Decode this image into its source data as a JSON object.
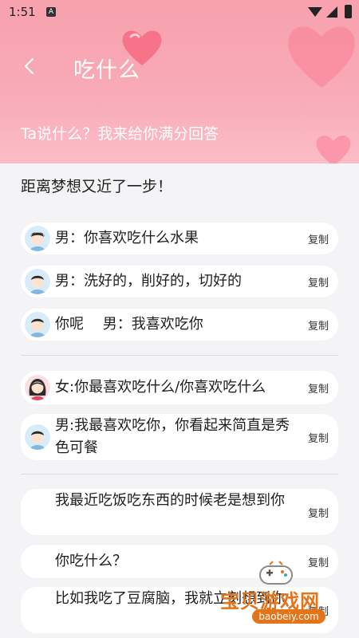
{
  "status_bar": {
    "time": "1:51",
    "notif_letter": "A"
  },
  "header": {
    "title": "吃什么",
    "subtitle": "Ta说什么？我来给你满分回答"
  },
  "content": {
    "section_title": "距离梦想又近了一步！",
    "copy_label": "复制",
    "groups": [
      {
        "items": [
          {
            "avatar": "male-avatar",
            "text": "男：你喜欢吃什么水果"
          },
          {
            "avatar": "male-avatar",
            "text": "男：洗好的，削好的，切好的"
          },
          {
            "avatar": "male-avatar",
            "text": "你呢　 男：我喜欢吃你"
          }
        ]
      },
      {
        "items": [
          {
            "avatar": "female-avatar",
            "text": "女:你最喜欢吃什么/你喜欢吃什么"
          },
          {
            "avatar": "male-avatar",
            "text": "男:我最喜欢吃你，你看起来简直是秀色可餐"
          }
        ]
      },
      {
        "items": [
          {
            "avatar": "",
            "text": "我最近吃饭吃东西的时候老是想到你"
          },
          {
            "avatar": "",
            "text": "你吃什么？"
          },
          {
            "avatar": "",
            "text": "比如我吃了豆腐脑，我就立刻想到你"
          }
        ]
      }
    ]
  },
  "watermark": {
    "text": "宝贝游戏网",
    "url": "baobeiy.com"
  },
  "colors": {
    "header_pink": "#f8aab7",
    "background": "#f4f4f6",
    "watermark": "#e3741a"
  }
}
